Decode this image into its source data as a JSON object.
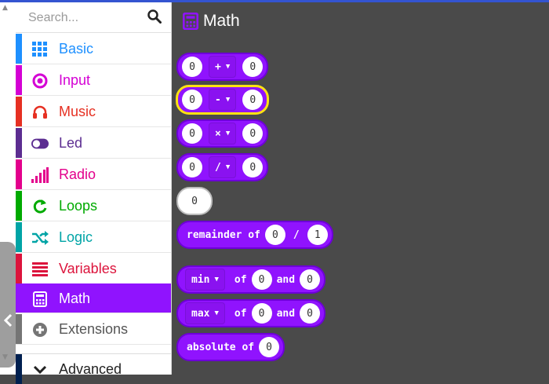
{
  "search": {
    "placeholder": "Search..."
  },
  "categories": [
    {
      "label": "Basic",
      "color": "#1e90ff",
      "icon": "grid-icon"
    },
    {
      "label": "Input",
      "color": "#d400d4",
      "icon": "target-icon"
    },
    {
      "label": "Music",
      "color": "#e63022",
      "icon": "headphones-icon"
    },
    {
      "label": "Led",
      "color": "#5c2d91",
      "icon": "toggle-icon"
    },
    {
      "label": "Radio",
      "color": "#e3008c",
      "icon": "signal-bars-icon"
    },
    {
      "label": "Loops",
      "color": "#00aa00",
      "icon": "loop-arrow-icon"
    },
    {
      "label": "Logic",
      "color": "#00a4a6",
      "icon": "shuffle-icon"
    },
    {
      "label": "Variables",
      "color": "#dc143c",
      "icon": "list-lines-icon"
    },
    {
      "label": "Math",
      "color": "#9013fe",
      "icon": "calculator-icon"
    },
    {
      "label": "Extensions",
      "color": "#757575",
      "icon": "plus-circle-icon"
    },
    {
      "label": "Advanced",
      "color": "#002050",
      "icon": "chevron-down-icon"
    }
  ],
  "workspace": {
    "title": "Math",
    "blocks": {
      "add": {
        "left": "0",
        "op": "+",
        "right": "0"
      },
      "sub": {
        "left": "0",
        "op": "-",
        "right": "0"
      },
      "mul": {
        "left": "0",
        "op": "×",
        "right": "0"
      },
      "div": {
        "left": "0",
        "op": "/",
        "right": "0"
      },
      "number": "0",
      "remainder": {
        "label": "remainder of",
        "a": "0",
        "sep": "/",
        "b": "1"
      },
      "min": {
        "fn": "min",
        "of": "of",
        "a": "0",
        "and": "and",
        "b": "0"
      },
      "max": {
        "fn": "max",
        "of": "of",
        "a": "0",
        "and": "and",
        "b": "0"
      },
      "absolute": {
        "label": "absolute of",
        "a": "0"
      }
    }
  },
  "colors": {
    "math": "#9013fe",
    "highlight": "#ffe211",
    "workspace_bg": "#4a4a4a"
  }
}
